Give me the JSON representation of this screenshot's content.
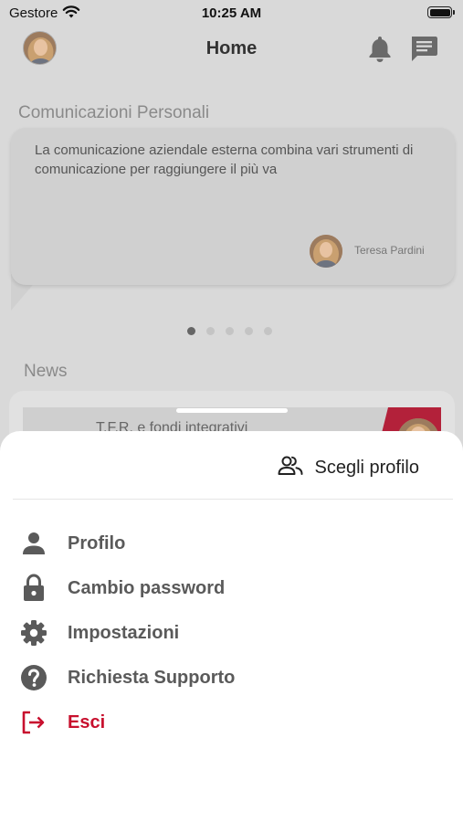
{
  "status_bar": {
    "carrier": "Gestore",
    "time": "10:25 AM"
  },
  "header": {
    "title": "Home"
  },
  "personal_comms": {
    "title": "Comunicazioni Personali",
    "text": "La comunicazione aziendale esterna combina vari strumenti di comunicazione per raggiungere il più va",
    "author": "Teresa Pardini",
    "page_count": 5,
    "active_page": 1
  },
  "news": {
    "title": "News",
    "item_title": "T.F.R. e fondi integrativi"
  },
  "sheet": {
    "choose_profile": "Scegli profilo",
    "items": [
      {
        "label": "Profilo",
        "icon": "person-icon"
      },
      {
        "label": "Cambio password",
        "icon": "lock-icon"
      },
      {
        "label": "Impostazioni",
        "icon": "gear-icon"
      },
      {
        "label": "Richiesta Supporto",
        "icon": "help-icon"
      },
      {
        "label": "Esci",
        "icon": "logout-icon"
      }
    ]
  },
  "colors": {
    "accent": "#c8102e",
    "menu_text": "#5a5a5a",
    "overlay_bg": "#d9d9d9"
  }
}
